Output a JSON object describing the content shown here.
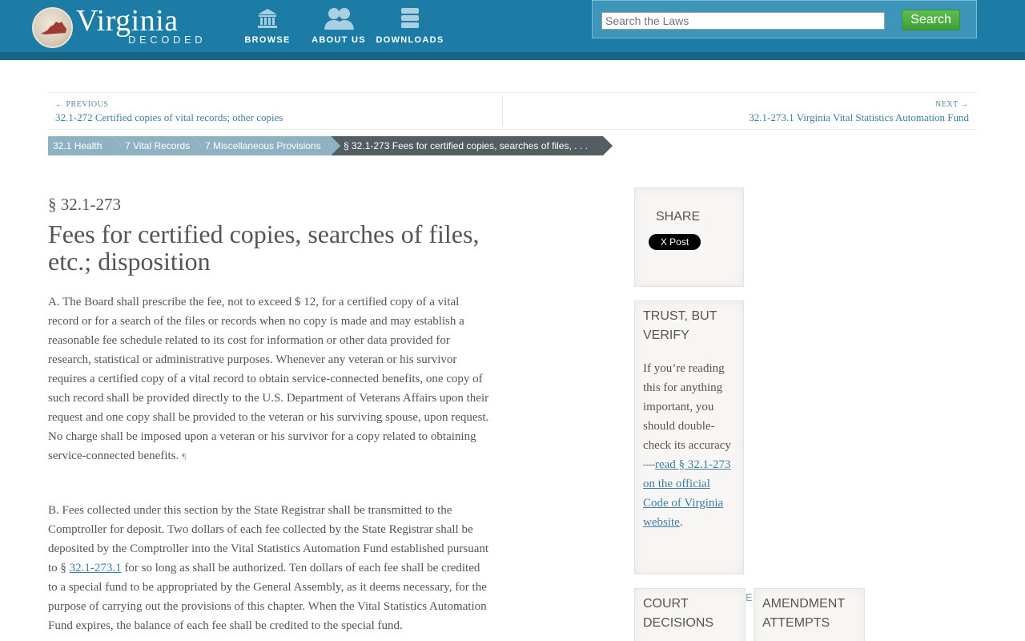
{
  "header": {
    "logo_title": "Virginia",
    "logo_subtitle": "DECODED",
    "nav": [
      {
        "label": "BROWSE",
        "icon": "building-icon"
      },
      {
        "label": "ABOUT US",
        "icon": "people-icon"
      },
      {
        "label": "DOWNLOADS",
        "icon": "database-icon"
      }
    ],
    "search": {
      "placeholder": "Search the Laws",
      "value": "",
      "button_label": "Search"
    }
  },
  "prevnext": {
    "prev_label": "← Previous",
    "prev_link": "32.1-272 Certified copies of vital records; other copies",
    "next_label": "Next →",
    "next_link": "32.1-273.1 Virginia Vital Statistics Automation Fund"
  },
  "breadcrumbs": [
    "32.1 Health",
    "7 Vital Records",
    "7 Miscellaneous Provisions",
    "§ 32.1-273 Fees for certified copies, searches of files, . . ."
  ],
  "law": {
    "section_number": "§ 32.1-273",
    "title": "Fees for certified copies, searches of files, etc.; disposition",
    "para_a": "A. The Board shall prescribe the fee, not to exceed $ 12, for a certified copy of a vital record or for a search of the files or records when no copy is made and may establish a reasonable fee schedule related to its cost for information or other data provided for research, statistical or administrative purposes. Whenever any veteran or his survivor requires a certified copy of a vital record to obtain service-connected benefits, one copy of such record shall be provided directly to the U.S. Department of Veterans Affairs upon their request and one copy shall be provided to the veteran or his surviving spouse, upon request. No charge shall be imposed upon a veteran or his survivor for a copy related to obtaining service-connected benefits.",
    "para_a_mark": "¶",
    "para_b_before": "B. Fees collected under this section by the State Registrar shall be transmitted to the Comptroller for deposit. Two dollars of each fee collected by the State Registrar shall be deposited by the Comptroller into the Vital Statistics Automation Fund established pursuant to § ",
    "para_b_link": "32.1-273.1",
    "para_b_after": " for so long as shall be authorized. Ten dollars of each fee shall be credited to a special fund to be appropriated by the General Assembly, as it deems necessary, for the purpose of carrying out the provisions of this chapter. When the Vital Statistics Automation Fund expires, the balance of each fee shall be credited to the special fund."
  },
  "sidebar": {
    "share_title": "SHARE",
    "x_post_label": "X Post",
    "trust_title": "TRUST, BUT VERIFY",
    "trust_text": "If you’re reading this for anything important, you should double-check its accuracy—",
    "trust_link": "read § 32.1-273 on the official Code of Virginia website",
    "trust_end": ".",
    "court_title": "COURT DECISIONS",
    "amend_title": "AMENDMENT ATTEMPTS",
    "stray_letter": "E"
  }
}
